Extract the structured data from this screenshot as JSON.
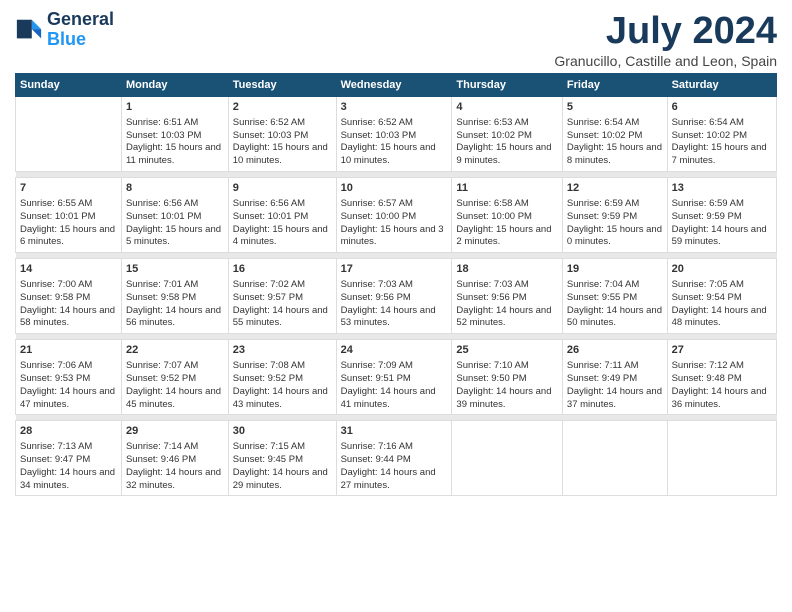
{
  "logo": {
    "line1": "General",
    "line2": "Blue"
  },
  "title": "July 2024",
  "subtitle": "Granucillo, Castille and Leon, Spain",
  "headers": [
    "Sunday",
    "Monday",
    "Tuesday",
    "Wednesday",
    "Thursday",
    "Friday",
    "Saturday"
  ],
  "weeks": [
    [
      {
        "day": "",
        "sunrise": "",
        "sunset": "",
        "daylight": ""
      },
      {
        "day": "1",
        "sunrise": "Sunrise: 6:51 AM",
        "sunset": "Sunset: 10:03 PM",
        "daylight": "Daylight: 15 hours and 11 minutes."
      },
      {
        "day": "2",
        "sunrise": "Sunrise: 6:52 AM",
        "sunset": "Sunset: 10:03 PM",
        "daylight": "Daylight: 15 hours and 10 minutes."
      },
      {
        "day": "3",
        "sunrise": "Sunrise: 6:52 AM",
        "sunset": "Sunset: 10:03 PM",
        "daylight": "Daylight: 15 hours and 10 minutes."
      },
      {
        "day": "4",
        "sunrise": "Sunrise: 6:53 AM",
        "sunset": "Sunset: 10:02 PM",
        "daylight": "Daylight: 15 hours and 9 minutes."
      },
      {
        "day": "5",
        "sunrise": "Sunrise: 6:54 AM",
        "sunset": "Sunset: 10:02 PM",
        "daylight": "Daylight: 15 hours and 8 minutes."
      },
      {
        "day": "6",
        "sunrise": "Sunrise: 6:54 AM",
        "sunset": "Sunset: 10:02 PM",
        "daylight": "Daylight: 15 hours and 7 minutes."
      }
    ],
    [
      {
        "day": "7",
        "sunrise": "Sunrise: 6:55 AM",
        "sunset": "Sunset: 10:01 PM",
        "daylight": "Daylight: 15 hours and 6 minutes."
      },
      {
        "day": "8",
        "sunrise": "Sunrise: 6:56 AM",
        "sunset": "Sunset: 10:01 PM",
        "daylight": "Daylight: 15 hours and 5 minutes."
      },
      {
        "day": "9",
        "sunrise": "Sunrise: 6:56 AM",
        "sunset": "Sunset: 10:01 PM",
        "daylight": "Daylight: 15 hours and 4 minutes."
      },
      {
        "day": "10",
        "sunrise": "Sunrise: 6:57 AM",
        "sunset": "Sunset: 10:00 PM",
        "daylight": "Daylight: 15 hours and 3 minutes."
      },
      {
        "day": "11",
        "sunrise": "Sunrise: 6:58 AM",
        "sunset": "Sunset: 10:00 PM",
        "daylight": "Daylight: 15 hours and 2 minutes."
      },
      {
        "day": "12",
        "sunrise": "Sunrise: 6:59 AM",
        "sunset": "Sunset: 9:59 PM",
        "daylight": "Daylight: 15 hours and 0 minutes."
      },
      {
        "day": "13",
        "sunrise": "Sunrise: 6:59 AM",
        "sunset": "Sunset: 9:59 PM",
        "daylight": "Daylight: 14 hours and 59 minutes."
      }
    ],
    [
      {
        "day": "14",
        "sunrise": "Sunrise: 7:00 AM",
        "sunset": "Sunset: 9:58 PM",
        "daylight": "Daylight: 14 hours and 58 minutes."
      },
      {
        "day": "15",
        "sunrise": "Sunrise: 7:01 AM",
        "sunset": "Sunset: 9:58 PM",
        "daylight": "Daylight: 14 hours and 56 minutes."
      },
      {
        "day": "16",
        "sunrise": "Sunrise: 7:02 AM",
        "sunset": "Sunset: 9:57 PM",
        "daylight": "Daylight: 14 hours and 55 minutes."
      },
      {
        "day": "17",
        "sunrise": "Sunrise: 7:03 AM",
        "sunset": "Sunset: 9:56 PM",
        "daylight": "Daylight: 14 hours and 53 minutes."
      },
      {
        "day": "18",
        "sunrise": "Sunrise: 7:03 AM",
        "sunset": "Sunset: 9:56 PM",
        "daylight": "Daylight: 14 hours and 52 minutes."
      },
      {
        "day": "19",
        "sunrise": "Sunrise: 7:04 AM",
        "sunset": "Sunset: 9:55 PM",
        "daylight": "Daylight: 14 hours and 50 minutes."
      },
      {
        "day": "20",
        "sunrise": "Sunrise: 7:05 AM",
        "sunset": "Sunset: 9:54 PM",
        "daylight": "Daylight: 14 hours and 48 minutes."
      }
    ],
    [
      {
        "day": "21",
        "sunrise": "Sunrise: 7:06 AM",
        "sunset": "Sunset: 9:53 PM",
        "daylight": "Daylight: 14 hours and 47 minutes."
      },
      {
        "day": "22",
        "sunrise": "Sunrise: 7:07 AM",
        "sunset": "Sunset: 9:52 PM",
        "daylight": "Daylight: 14 hours and 45 minutes."
      },
      {
        "day": "23",
        "sunrise": "Sunrise: 7:08 AM",
        "sunset": "Sunset: 9:52 PM",
        "daylight": "Daylight: 14 hours and 43 minutes."
      },
      {
        "day": "24",
        "sunrise": "Sunrise: 7:09 AM",
        "sunset": "Sunset: 9:51 PM",
        "daylight": "Daylight: 14 hours and 41 minutes."
      },
      {
        "day": "25",
        "sunrise": "Sunrise: 7:10 AM",
        "sunset": "Sunset: 9:50 PM",
        "daylight": "Daylight: 14 hours and 39 minutes."
      },
      {
        "day": "26",
        "sunrise": "Sunrise: 7:11 AM",
        "sunset": "Sunset: 9:49 PM",
        "daylight": "Daylight: 14 hours and 37 minutes."
      },
      {
        "day": "27",
        "sunrise": "Sunrise: 7:12 AM",
        "sunset": "Sunset: 9:48 PM",
        "daylight": "Daylight: 14 hours and 36 minutes."
      }
    ],
    [
      {
        "day": "28",
        "sunrise": "Sunrise: 7:13 AM",
        "sunset": "Sunset: 9:47 PM",
        "daylight": "Daylight: 14 hours and 34 minutes."
      },
      {
        "day": "29",
        "sunrise": "Sunrise: 7:14 AM",
        "sunset": "Sunset: 9:46 PM",
        "daylight": "Daylight: 14 hours and 32 minutes."
      },
      {
        "day": "30",
        "sunrise": "Sunrise: 7:15 AM",
        "sunset": "Sunset: 9:45 PM",
        "daylight": "Daylight: 14 hours and 29 minutes."
      },
      {
        "day": "31",
        "sunrise": "Sunrise: 7:16 AM",
        "sunset": "Sunset: 9:44 PM",
        "daylight": "Daylight: 14 hours and 27 minutes."
      },
      {
        "day": "",
        "sunrise": "",
        "sunset": "",
        "daylight": ""
      },
      {
        "day": "",
        "sunrise": "",
        "sunset": "",
        "daylight": ""
      },
      {
        "day": "",
        "sunrise": "",
        "sunset": "",
        "daylight": ""
      }
    ]
  ]
}
